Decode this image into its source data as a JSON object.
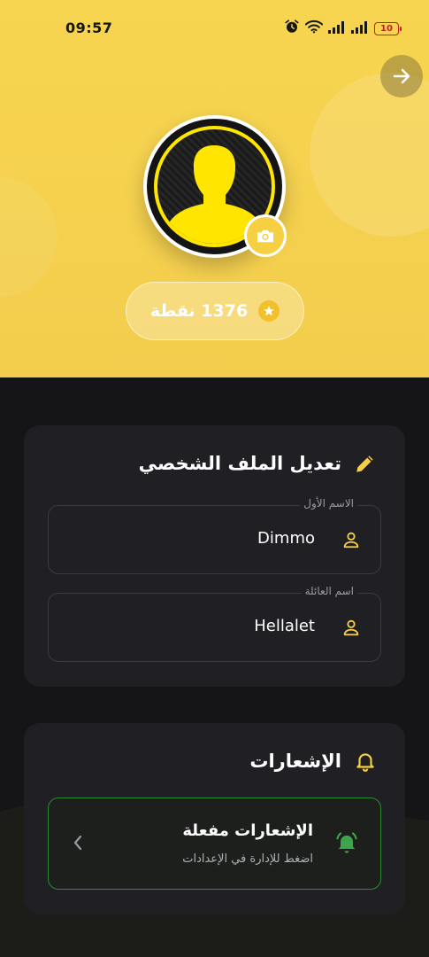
{
  "status_bar": {
    "time": "09:57",
    "battery": "10"
  },
  "profile": {
    "points_label": "1376 نقطة"
  },
  "edit_profile": {
    "title": "تعديل الملف الشخصي",
    "first_name": {
      "label": "الاسم الأول",
      "value": "Dimmo"
    },
    "last_name": {
      "label": "اسم العائلة",
      "value": "Hellalet"
    }
  },
  "notifications": {
    "title": "الإشعارات",
    "status_title": "الإشعارات مفعلة",
    "status_subtitle": "اضغط للإدارة في الإعدادات"
  },
  "colors": {
    "accent": "#f6cf42",
    "success": "#3fa34d",
    "card": "#202024"
  }
}
